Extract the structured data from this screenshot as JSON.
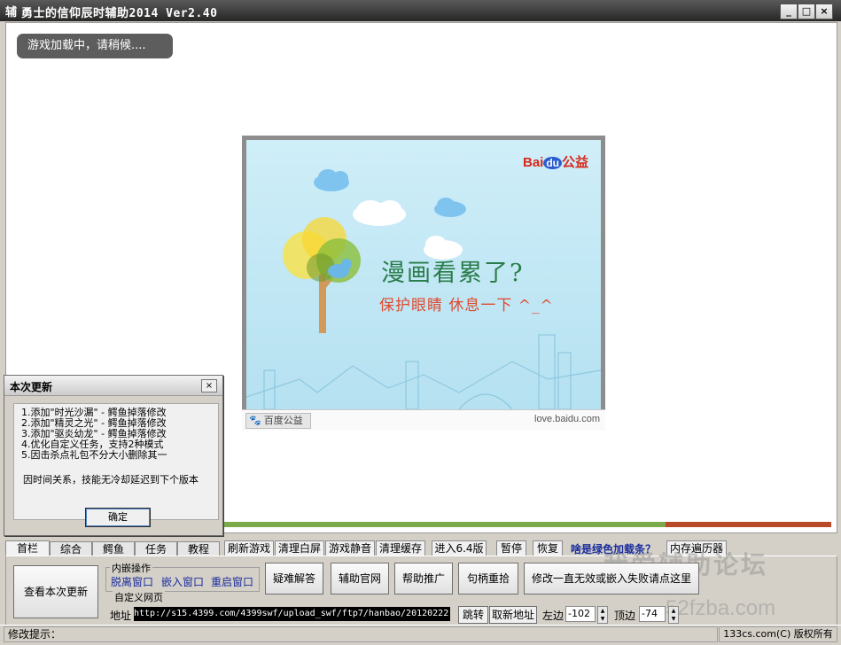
{
  "window": {
    "app_icon_char": "辅",
    "title": "勇士的信仰辰时辅助2014 Ver2.40",
    "min": "_",
    "max": "□",
    "close": "×"
  },
  "game": {
    "loading_message": "游戏加载中，请稍候....",
    "ad": {
      "logo_text_1": "Bai",
      "logo_text_2": "du",
      "logo_text_3": "公益",
      "headline": "漫画看累了?",
      "subline": "保护眼睛 休息一下 ^_^",
      "footer_badge": "百度公益",
      "footer_url": "love.baidu.com"
    },
    "progress_fraction": 0.73
  },
  "popup": {
    "title": "本次更新",
    "close": "×",
    "items": [
      "1.添加\"时光沙漏\" - 鳄鱼掉落修改",
      "2.添加\"精灵之光\" - 鳄鱼掉落修改",
      "3.添加\"驱炎幼龙\" - 鳄鱼掉落修改",
      "4.优化自定义任务，支持2种模式",
      "5.因击杀点礼包不分大小删除其一"
    ],
    "note": "因时间关系，技能无冷却延迟到下个版本",
    "ok": "确定"
  },
  "tabs": [
    "首栏",
    "综合",
    "鳄鱼",
    "任务",
    "教程"
  ],
  "toolbar": {
    "refresh": "刷新游戏",
    "clear_white": "清理白屏",
    "mute": "游戏静音",
    "clear_cache": "清理缓存",
    "enter": "进入6.4版",
    "pause": "暂停",
    "resume": "恢复",
    "green_bar_link": "啥是绿色加载条？",
    "mem_walker": "内存遍历器"
  },
  "panel": {
    "view_update": "查看本次更新",
    "embed_group_label": "内嵌操作",
    "detach": "脱离窗口",
    "embed": "嵌入窗口",
    "reset": "重启窗口",
    "faq": "疑难解答",
    "official": "辅助官网",
    "promote": "帮助推广",
    "handle_pick": "句柄重拾",
    "fix_embed": "修改一直无效或嵌入失败请点这里",
    "custom_group_label": "自定义网页",
    "addr_label": "地址",
    "addr_value": "http://s15.4399.com/4399swf/upload_swf/ftp7/hanbao/20120222",
    "jump": "跳转",
    "refresh_addr": "取新地址",
    "left_label": "左边",
    "left_value": "-102",
    "top_label": "顶边",
    "top_value": "-74"
  },
  "watermark": {
    "line1": "我爱辅助论坛",
    "line2": "52fzba.com"
  },
  "status": {
    "hint_label": "修改提示：",
    "copyright": "133cs.com(C) 版权所有"
  }
}
